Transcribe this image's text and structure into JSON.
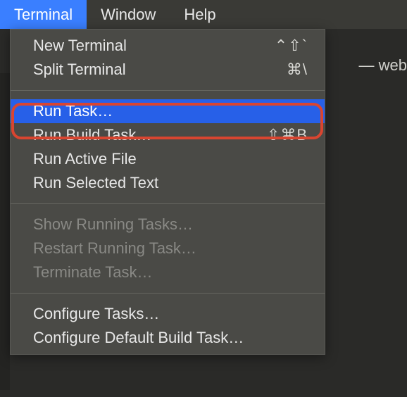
{
  "menubar": {
    "terminal": "Terminal",
    "window": "Window",
    "help": "Help"
  },
  "background": {
    "tab_fragment": "— web"
  },
  "menu": {
    "section1": [
      {
        "label": "New Terminal",
        "shortcut": "⌃⇧`"
      },
      {
        "label": "Split Terminal",
        "shortcut": "⌘\\"
      }
    ],
    "section2": [
      {
        "label": "Run Task…",
        "shortcut": ""
      },
      {
        "label": "Run Build Task…",
        "shortcut": "⇧⌘B"
      },
      {
        "label": "Run Active File",
        "shortcut": ""
      },
      {
        "label": "Run Selected Text",
        "shortcut": ""
      }
    ],
    "section3": [
      {
        "label": "Show Running Tasks…",
        "shortcut": ""
      },
      {
        "label": "Restart Running Task…",
        "shortcut": ""
      },
      {
        "label": "Terminate Task…",
        "shortcut": ""
      }
    ],
    "section4": [
      {
        "label": "Configure Tasks…",
        "shortcut": ""
      },
      {
        "label": "Configure Default Build Task…",
        "shortcut": ""
      }
    ]
  }
}
